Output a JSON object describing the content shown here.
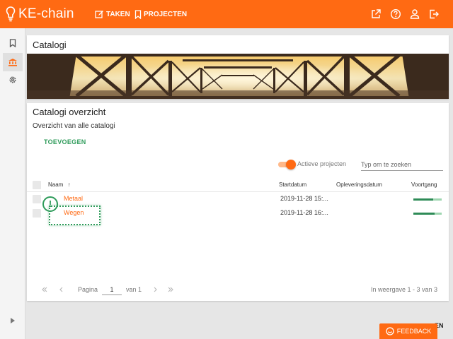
{
  "app": {
    "name": "KE-chain"
  },
  "topnav": {
    "items": [
      {
        "label": "TAKEN",
        "icon": "edit-icon"
      },
      {
        "label": "PROJECTEN",
        "icon": "bookmark-icon"
      }
    ],
    "right_icons": [
      "external-link-icon",
      "help-icon",
      "user-icon",
      "logout-icon"
    ]
  },
  "sidebar": {
    "items": [
      {
        "icon": "bookmark-icon",
        "active": false
      },
      {
        "icon": "institution-icon",
        "active": true
      },
      {
        "icon": "gear-icon",
        "active": false
      }
    ]
  },
  "header_card": {
    "title": "Catalogi"
  },
  "overview": {
    "title": "Catalogi overzicht",
    "subtitle": "Overzicht van alle catalogi",
    "add_label": "TOEVOEGEN",
    "toggle_label": "Actieve projecten",
    "toggle_on": true,
    "search_placeholder": "Typ om te zoeken",
    "columns": {
      "name": "Naam",
      "start": "Startdatum",
      "delivery": "Opleveringsdatum",
      "progress": "Voortgang"
    },
    "rows": [
      {
        "name": "Metaal",
        "start": "2019-11-28 15:...",
        "delivery": "",
        "progress": 0.7
      },
      {
        "name": "Wegen",
        "start": "2019-11-28 16:...",
        "delivery": "",
        "progress": 0.75
      }
    ],
    "pagination": {
      "page_label": "Pagina",
      "page_value": "1",
      "of_label": "van 1",
      "summary": "In weergave 1 - 3 van 3"
    }
  },
  "feedback": {
    "label": "FEEDBACK"
  },
  "background_text": "EN",
  "colors": {
    "brand": "#ff6a13",
    "accent_green": "#2e9b5a"
  }
}
